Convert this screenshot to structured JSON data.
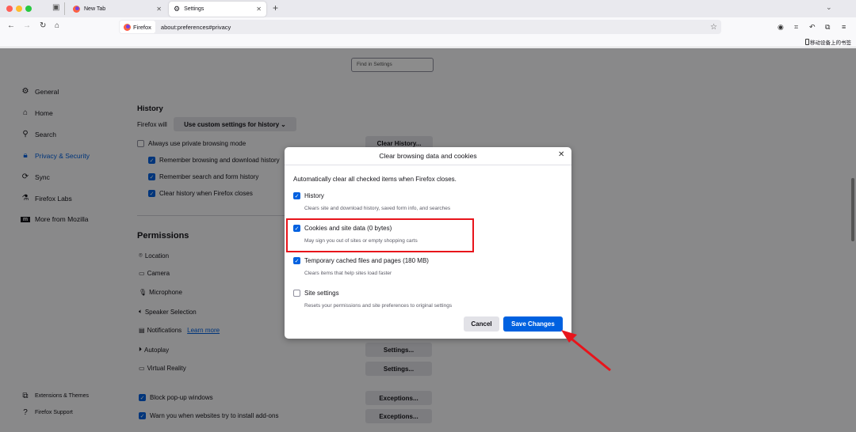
{
  "browser": {
    "tabs": [
      {
        "label": "New Tab",
        "active": false
      },
      {
        "label": "Settings",
        "active": true
      }
    ],
    "identity_label": "Firefox",
    "url": "about:preferences#privacy",
    "bookmark_label": "移动设备上的书签"
  },
  "search": {
    "placeholder": "Find in Settings"
  },
  "sidebar": {
    "items": [
      {
        "label": "General",
        "icon": "gear-icon"
      },
      {
        "label": "Home",
        "icon": "home-icon"
      },
      {
        "label": "Search",
        "icon": "search-icon"
      },
      {
        "label": "Privacy & Security",
        "icon": "lock-icon",
        "active": true
      },
      {
        "label": "Sync",
        "icon": "sync-icon"
      },
      {
        "label": "Firefox Labs",
        "icon": "flask-icon"
      },
      {
        "label": "More from Mozilla",
        "icon": "mozilla-icon"
      }
    ],
    "footer": [
      {
        "label": "Extensions & Themes"
      },
      {
        "label": "Firefox Support"
      }
    ]
  },
  "history": {
    "heading": "History",
    "firefox_will": "Firefox will",
    "mode": "Use custom settings for history",
    "clear_button": "Clear History...",
    "options": [
      {
        "label": "Always use private browsing mode",
        "checked": false
      },
      {
        "label": "Remember browsing and download history",
        "checked": true
      },
      {
        "label": "Remember search and form history",
        "checked": true
      },
      {
        "label": "Clear history when Firefox closes",
        "checked": true
      }
    ]
  },
  "permissions": {
    "heading": "Permissions",
    "items": [
      "Location",
      "Camera",
      "Microphone",
      "Speaker Selection",
      "Notifications",
      "Autoplay",
      "Virtual Reality"
    ],
    "learn_more": "Learn more",
    "settings_button": "Settings...",
    "exceptions_button": "Exceptions...",
    "checks": [
      {
        "label": "Block pop-up windows",
        "checked": true
      },
      {
        "label": "Warn you when websites try to install add-ons",
        "checked": true
      }
    ]
  },
  "dialog": {
    "title": "Clear browsing data and cookies",
    "intro": "Automatically clear all checked items when Firefox closes.",
    "items": [
      {
        "label": "History",
        "desc": "Clears site and download history, saved form info, and searches",
        "checked": true
      },
      {
        "label": "Cookies and site data (0 bytes)",
        "desc": "May sign you out of sites or empty shopping carts",
        "checked": true
      },
      {
        "label": "Temporary cached files and pages (180 MB)",
        "desc": "Clears items that help sites load faster",
        "checked": true
      },
      {
        "label": "Site settings",
        "desc": "Resets your permissions and site preferences to original settings",
        "checked": false
      }
    ],
    "cancel": "Cancel",
    "save": "Save Changes"
  },
  "colors": {
    "accent": "#0061e0",
    "highlight": "#e8141b"
  }
}
